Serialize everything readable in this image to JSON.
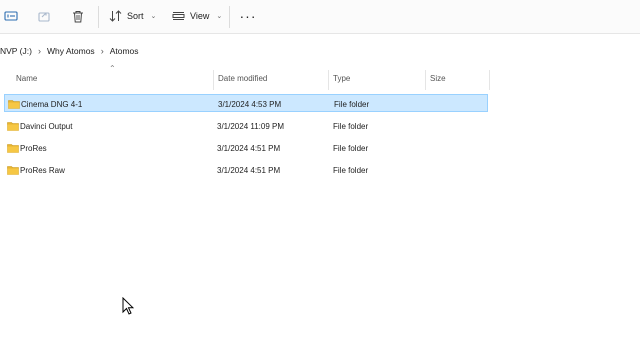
{
  "toolbar": {
    "sort_label": "Sort",
    "view_label": "View",
    "more_label": "···"
  },
  "breadcrumb": {
    "items": [
      "NVP (J:)",
      "Why Atomos",
      "Atomos"
    ]
  },
  "columns": {
    "name": "Name",
    "date": "Date modified",
    "type": "Type",
    "size": "Size"
  },
  "rows": [
    {
      "name": "Cinema DNG  4-1",
      "date": "3/1/2024 4:53 PM",
      "type": "File folder",
      "size": "",
      "selected": true
    },
    {
      "name": "Davinci Output",
      "date": "3/1/2024 11:09 PM",
      "type": "File folder",
      "size": ""
    },
    {
      "name": "ProRes",
      "date": "3/1/2024 4:51 PM",
      "type": "File folder",
      "size": ""
    },
    {
      "name": "ProRes Raw",
      "date": "3/1/2024 4:51 PM",
      "type": "File folder",
      "size": ""
    }
  ],
  "colors": {
    "folder": "#e8b530",
    "selection_bg": "#cce8ff",
    "selection_border": "#99d1ff"
  }
}
